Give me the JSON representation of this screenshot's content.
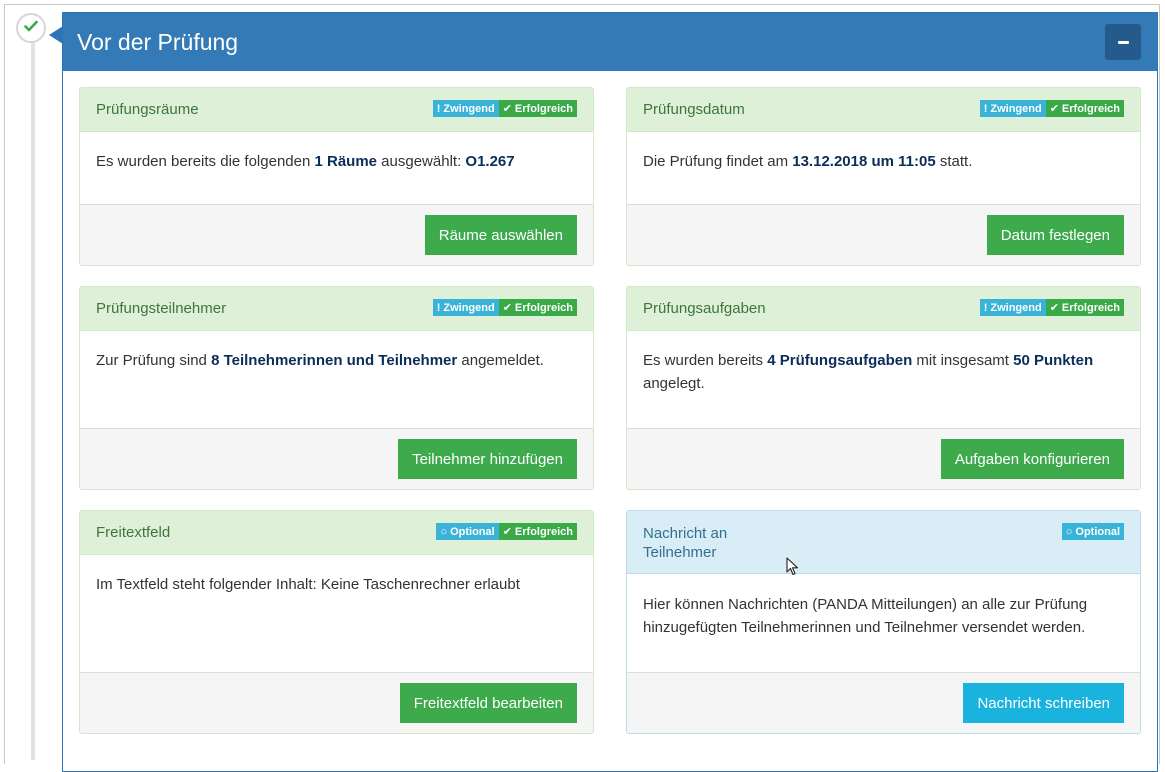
{
  "section": {
    "title": "Vor der Prüfung",
    "collapse_label": "−",
    "timeline_icon": "check-icon",
    "accent": "#337ab7"
  },
  "cards": {
    "rooms": {
      "title": "Prüfungsräume",
      "badges": [
        "Zwingend",
        "Erfolgreich"
      ],
      "text_before": "Es wurden bereits die folgenden ",
      "strong1": "1 Räume",
      "text_mid": " ausgewählt: ",
      "strong2": "O1.267",
      "button": "Räume auswählen"
    },
    "date": {
      "title": "Prüfungsdatum",
      "badges": [
        "Zwingend",
        "Erfolgreich"
      ],
      "text_before": "Die Prüfung findet am ",
      "strong1": "13.12.2018 um 11:05",
      "text_after": " statt.",
      "button": "Datum festlegen"
    },
    "participants": {
      "title": "Prüfungsteilnehmer",
      "badges": [
        "Zwingend",
        "Erfolgreich"
      ],
      "text_before": "Zur Prüfung sind ",
      "strong1": "8 Teilnehmerinnen und Teilnehmer",
      "text_after": " angemeldet.",
      "button": "Teilnehmer hinzufügen"
    },
    "tasks": {
      "title": "Prüfungsaufgaben",
      "badges": [
        "Zwingend",
        "Erfolgreich"
      ],
      "text_before": "Es wurden bereits ",
      "strong1": "4 Prüfungsaufgaben",
      "text_mid": " mit insgesamt ",
      "strong2": "50 Punkten",
      "text_after": " angelegt.",
      "button": "Aufgaben konfigurieren"
    },
    "freetext": {
      "title": "Freitextfeld",
      "badges": [
        "Optional",
        "Erfolgreich"
      ],
      "text": "Im Textfeld steht folgender Inhalt: Keine Taschenrechner erlaubt",
      "button": "Freitextfeld bearbeiten"
    },
    "message": {
      "title": "Nachricht an Teilnehmer",
      "badges": [
        "Optional"
      ],
      "text": "Hier können Nachrichten (PANDA Mitteilungen) an alle zur Prüfung hinzugefügten Teilnehmerinnen und Teilnehmer versendet werden.",
      "button": "Nachricht schreiben"
    }
  },
  "colors": {
    "success_bg": "#dff0d8",
    "info_bg": "#d9edf7",
    "button_green": "#3daa4b",
    "button_cyan": "#1ab3de",
    "badge_blue": "#39b3d7",
    "badge_green": "#3aaa48"
  }
}
